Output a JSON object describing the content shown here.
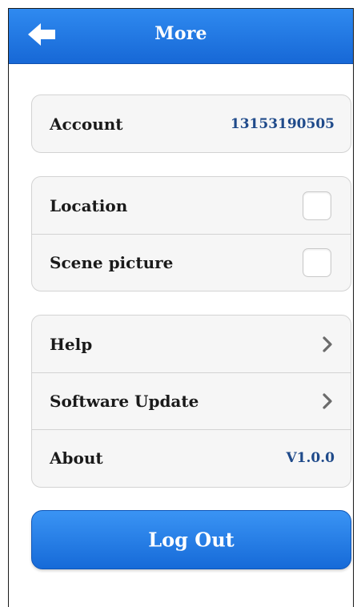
{
  "header": {
    "title": "More",
    "back_icon": "arrow-left-icon",
    "background_color": "#1d72dd"
  },
  "account_group": {
    "account_label": "Account",
    "account_value": "13153190505"
  },
  "settings_group": {
    "location_label": "Location",
    "location_checked": false,
    "scene_picture_label": "Scene picture",
    "scene_picture_checked": false
  },
  "info_group": {
    "help_label": "Help",
    "help_icon": "chevron-right-icon",
    "software_update_label": "Software Update",
    "software_update_icon": "chevron-right-icon",
    "about_label": "About",
    "about_value": "V1.0.0"
  },
  "logout": {
    "label": "Log Out",
    "background_color": "#2580e8"
  }
}
